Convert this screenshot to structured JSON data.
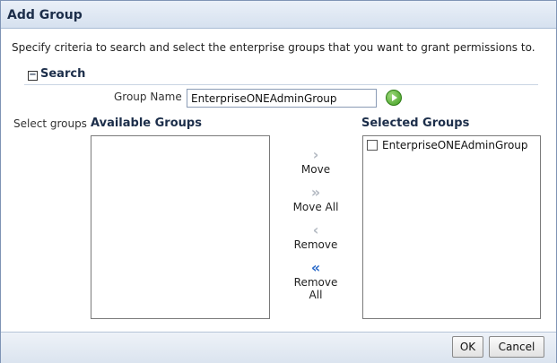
{
  "dialog": {
    "title": "Add Group",
    "instructions": "Specify criteria to search and select the enterprise groups that you want to grant permissions to."
  },
  "search": {
    "header": "Search",
    "group_name_label": "Group Name",
    "group_name_value": "EnterpriseONEAdminGroup"
  },
  "shuttle": {
    "select_label": "Select groups",
    "available_label": "Available Groups",
    "selected_label": "Selected Groups",
    "available_items": [],
    "selected_items": [
      {
        "label": "EnterpriseONEAdminGroup",
        "checked": false
      }
    ],
    "buttons": {
      "move": "Move",
      "move_all": "Move All",
      "remove": "Remove",
      "remove_all": "Remove All"
    }
  },
  "footer": {
    "ok": "OK",
    "cancel": "Cancel"
  },
  "icons": {
    "collapse": "minus-box-icon",
    "go": "go-arrow-icon",
    "move": "chevron-right-icon",
    "move_all": "double-chevron-right-icon",
    "remove": "chevron-left-icon",
    "remove_all": "double-chevron-left-icon"
  },
  "colors": {
    "title_bar": "#d6e1ef",
    "accent_blue": "#2a6ac9",
    "go_green": "#3e9d1e"
  }
}
